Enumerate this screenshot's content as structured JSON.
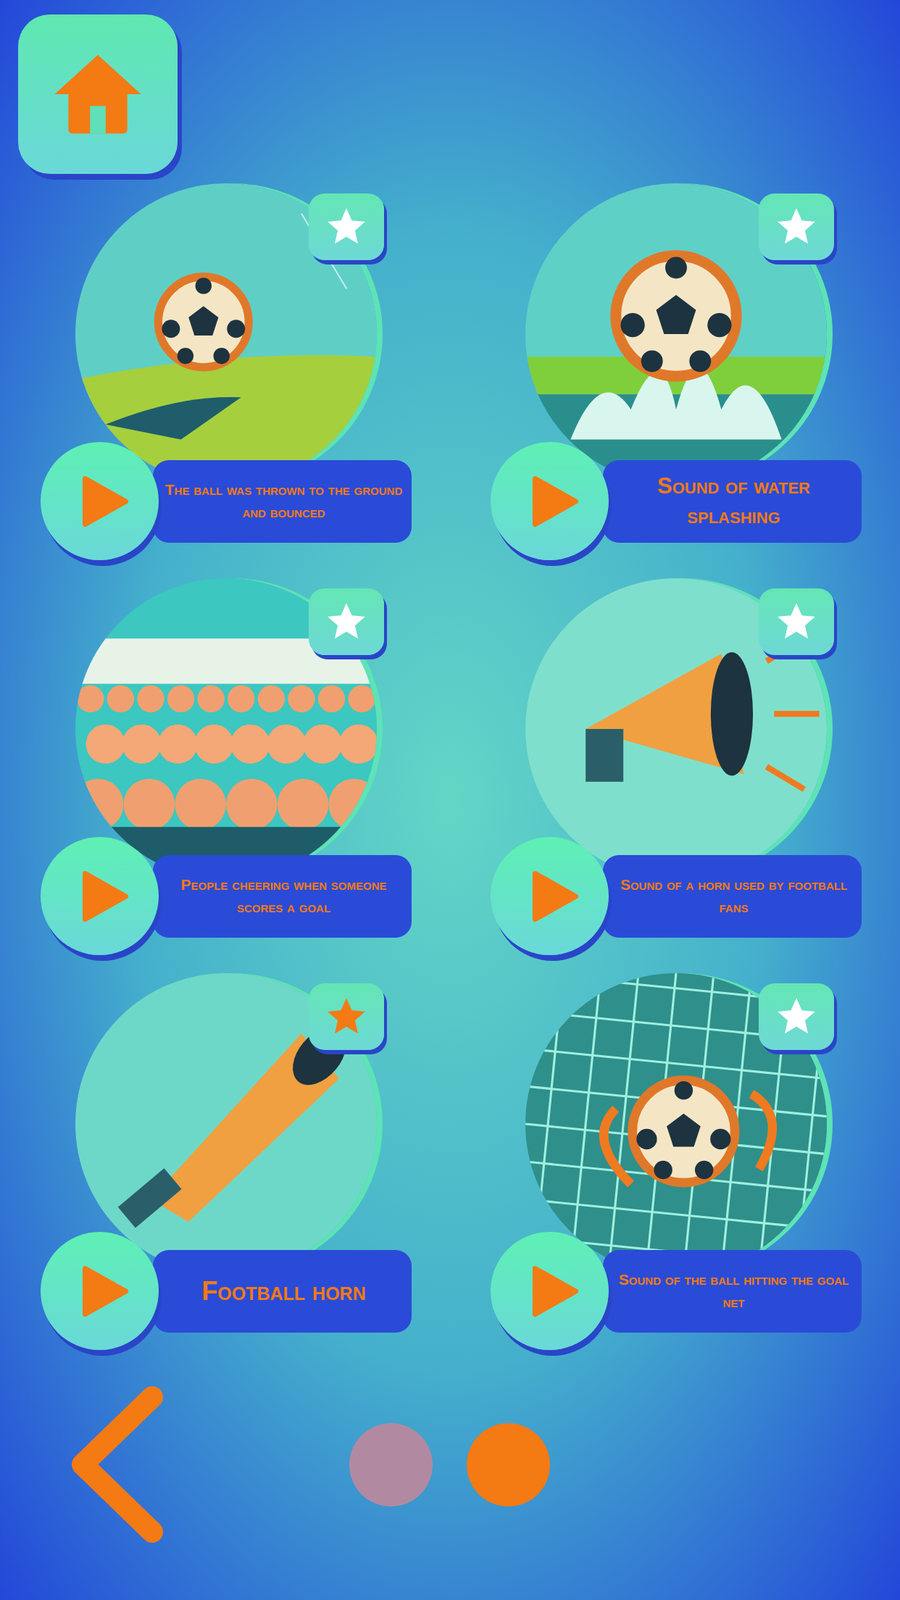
{
  "sounds": [
    {
      "label": "The ball was thrown to the ground and bounced",
      "kind": "bounce",
      "favorite": false
    },
    {
      "label": "Sound of water splashing",
      "kind": "splash",
      "favorite": false
    },
    {
      "label": "People cheering when someone scores a goal",
      "kind": "crowd",
      "favorite": false
    },
    {
      "label": "Sound of a horn used by football fans",
      "kind": "megaphone",
      "favorite": false
    },
    {
      "label": "Football horn",
      "kind": "horn",
      "favorite": true
    },
    {
      "label": "Sound of the ball hitting the goal net",
      "kind": "net",
      "favorite": false
    }
  ],
  "pagination": {
    "pages": [
      {
        "selected": false
      },
      {
        "selected": true
      }
    ]
  }
}
